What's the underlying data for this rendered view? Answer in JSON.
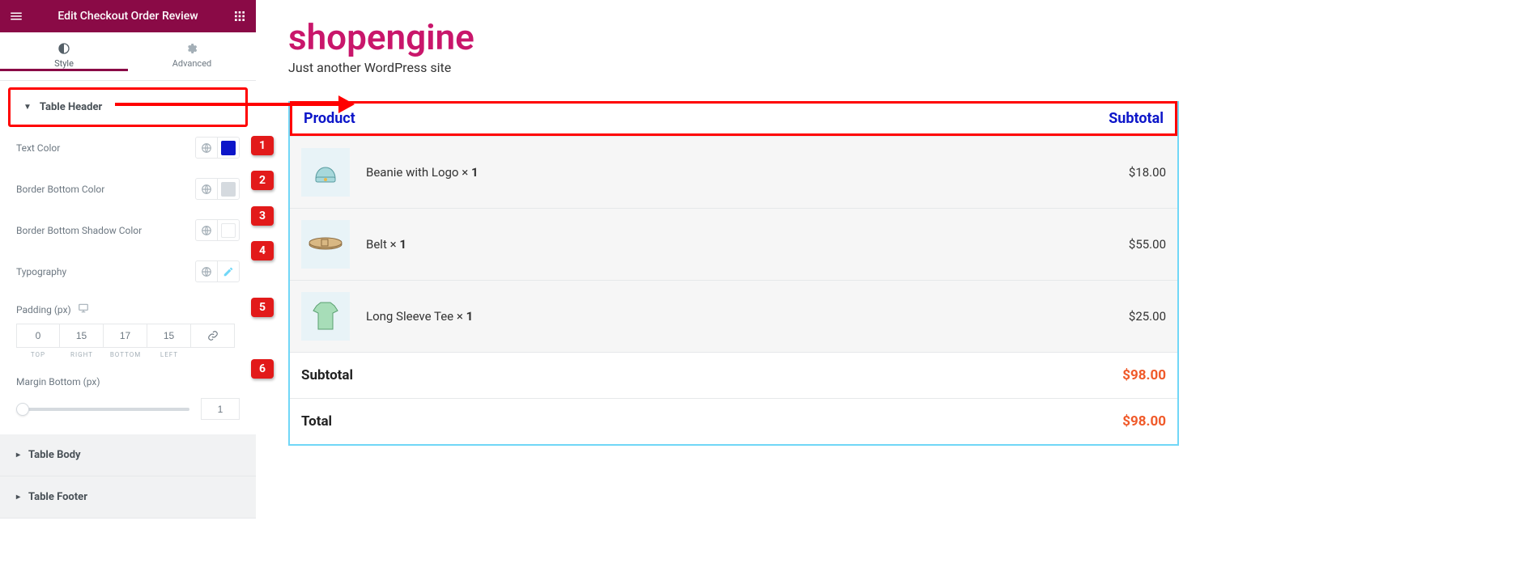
{
  "panel": {
    "title": "Edit Checkout Order Review",
    "tabs": {
      "style": "Style",
      "advanced": "Advanced"
    },
    "sections": {
      "header": "Table Header",
      "body": "Table Body",
      "footer": "Table Footer"
    },
    "controls": {
      "text_color": {
        "label": "Text Color",
        "value": "#0d16c9"
      },
      "border_bottom_color": {
        "label": "Border Bottom Color",
        "value": "#d5dadf"
      },
      "border_bottom_shadow": {
        "label": "Border Bottom Shadow Color",
        "value": ""
      },
      "typography": {
        "label": "Typography"
      },
      "padding": {
        "label": "Padding (px)",
        "top": "0",
        "right": "15",
        "bottom": "17",
        "left": "15",
        "lab_top": "TOP",
        "lab_right": "RIGHT",
        "lab_bottom": "BOTTOM",
        "lab_left": "LEFT"
      },
      "margin_bottom": {
        "label": "Margin Bottom (px)",
        "value": "1"
      }
    }
  },
  "annotations": {
    "1": "1",
    "2": "2",
    "3": "3",
    "4": "4",
    "5": "5",
    "6": "6"
  },
  "preview": {
    "site_title": "shopengine",
    "tagline": "Just another WordPress site",
    "headers": {
      "product": "Product",
      "subtotal": "Subtotal"
    },
    "items": [
      {
        "name": "Beanie with Logo",
        "qty": "1",
        "price": "$18.00",
        "icon": "beanie"
      },
      {
        "name": "Belt",
        "qty": "1",
        "price": "$55.00",
        "icon": "belt"
      },
      {
        "name": "Long Sleeve Tee",
        "qty": "1",
        "price": "$25.00",
        "icon": "tee"
      }
    ],
    "subtotal": {
      "label": "Subtotal",
      "value": "$98.00"
    },
    "total": {
      "label": "Total",
      "value": "$98.00"
    },
    "qty_sep": " × "
  }
}
